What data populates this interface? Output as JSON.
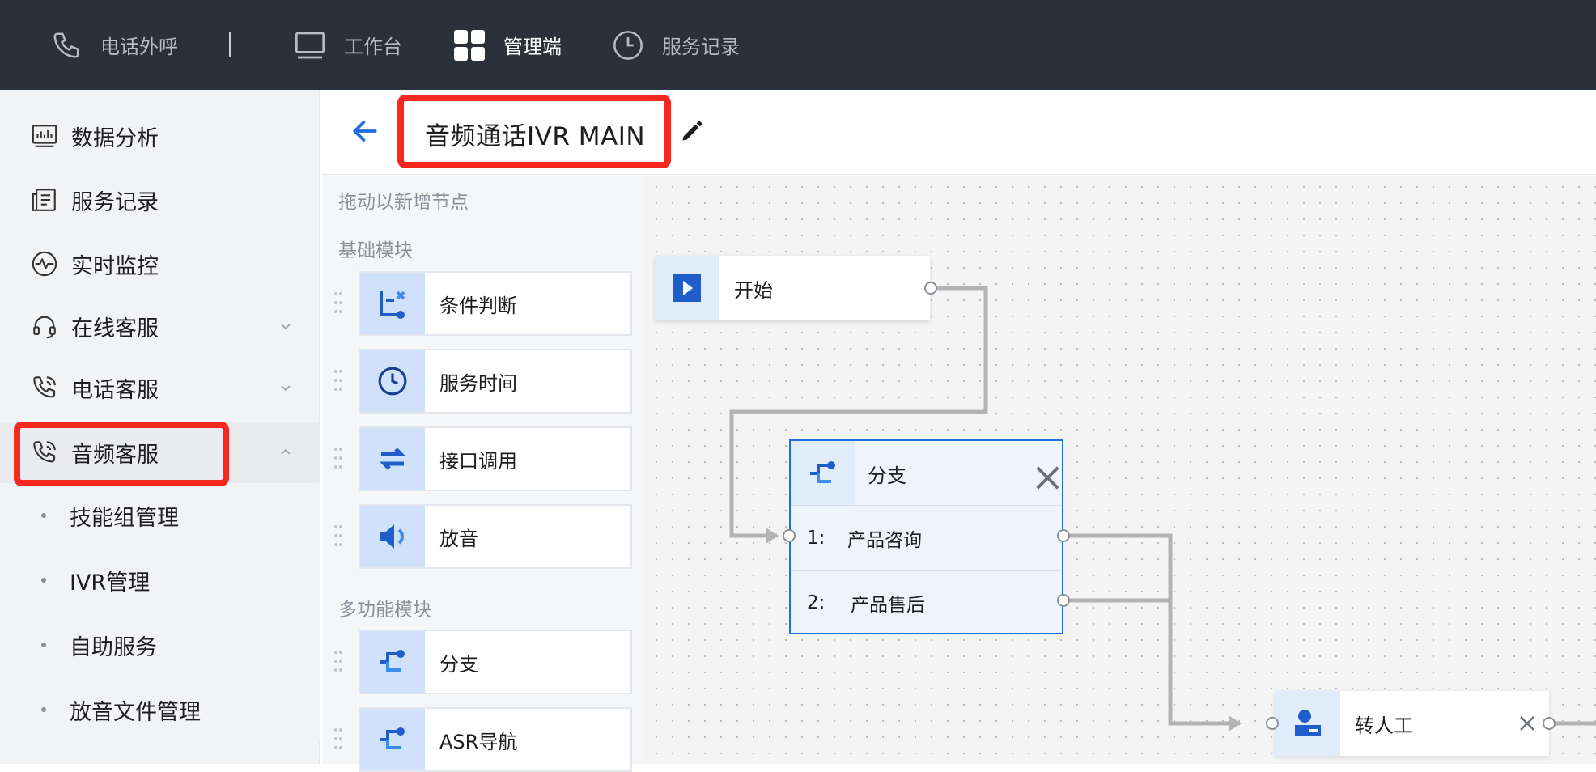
{
  "topbar": {
    "items": [
      {
        "label": "电话外呼",
        "icon": "phone-icon"
      },
      {
        "label": "工作台",
        "icon": "monitor-icon"
      },
      {
        "label": "管理端",
        "icon": "grid-icon",
        "active": true
      },
      {
        "label": "服务记录",
        "icon": "clock-icon"
      }
    ]
  },
  "sidebar": {
    "items": [
      {
        "label": "数据分析",
        "icon": "chart-icon"
      },
      {
        "label": "服务记录",
        "icon": "records-icon"
      },
      {
        "label": "实时监控",
        "icon": "pulse-icon"
      },
      {
        "label": "在线客服",
        "icon": "headset-icon",
        "chevron": "down"
      },
      {
        "label": "电话客服",
        "icon": "phone-call-icon",
        "chevron": "down"
      },
      {
        "label": "音频客服",
        "icon": "phone-call-icon",
        "chevron": "up"
      }
    ],
    "sub_items": [
      "技能组管理",
      "IVR管理",
      "自助服务",
      "放音文件管理"
    ]
  },
  "header": {
    "title": "音频通话IVR MAIN"
  },
  "palette": {
    "hint": "拖动以新增节点",
    "basic_section": "基础模块",
    "basic_modules": [
      {
        "label": "条件判断",
        "icon": "condition-icon"
      },
      {
        "label": "服务时间",
        "icon": "clock-icon"
      },
      {
        "label": "接口调用",
        "icon": "api-icon"
      },
      {
        "label": "放音",
        "icon": "speaker-icon"
      }
    ],
    "multi_section": "多功能模块",
    "multi_modules": [
      {
        "label": "分支",
        "icon": "branch-icon"
      },
      {
        "label": "ASR导航",
        "icon": "branch-icon"
      }
    ]
  },
  "canvas": {
    "start_node": {
      "label": "开始"
    },
    "branch_node": {
      "label": "分支",
      "options": [
        {
          "num": "1:",
          "text": "产品咨询"
        },
        {
          "num": "2:",
          "text": "产品售后"
        }
      ]
    },
    "transfer_node": {
      "label": "转人工"
    }
  },
  "colors": {
    "topbar": "#2b313b",
    "accent": "#1f6fe0",
    "highlight": "#f6281f"
  }
}
